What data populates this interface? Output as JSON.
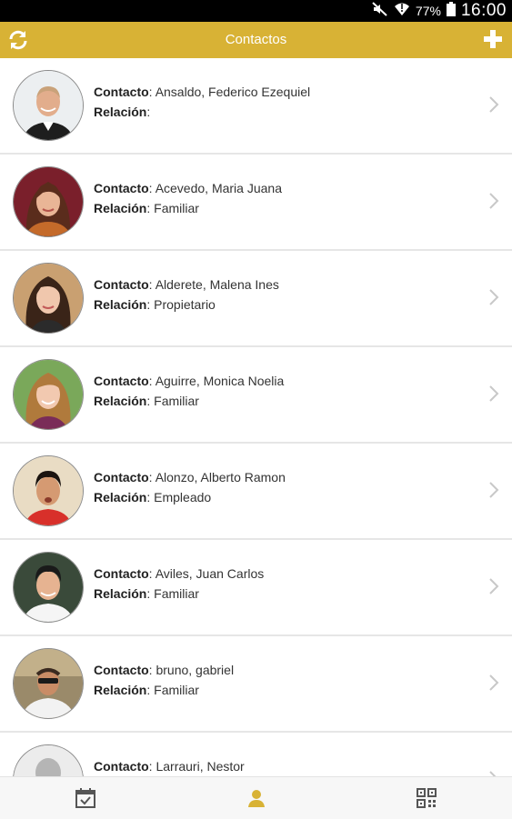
{
  "status_bar": {
    "battery": "77%",
    "time": "16:00"
  },
  "appbar": {
    "title": "Contactos",
    "left_icon": "refresh-icon",
    "right_icon": "plus-icon"
  },
  "labels": {
    "contacto": "Contacto",
    "relacion": "Relación",
    "sep": ": "
  },
  "contacts": [
    {
      "name": "Ansaldo, Federico Ezequiel",
      "relation": ""
    },
    {
      "name": "Acevedo, Maria Juana",
      "relation": "Familiar"
    },
    {
      "name": "Alderete, Malena Ines",
      "relation": "Propietario"
    },
    {
      "name": "Aguirre, Monica Noelia",
      "relation": "Familiar"
    },
    {
      "name": "Alonzo, Alberto Ramon",
      "relation": "Empleado"
    },
    {
      "name": "Aviles, Juan Carlos",
      "relation": "Familiar"
    },
    {
      "name": "bruno, gabriel",
      "relation": "Familiar"
    },
    {
      "name": "Larrauri, Nestor",
      "relation": ""
    }
  ],
  "bottom_nav": [
    {
      "icon": "calendar-check-icon",
      "active": false
    },
    {
      "icon": "person-icon",
      "active": true
    },
    {
      "icon": "qr-code-icon",
      "active": false
    }
  ],
  "colors": {
    "accent": "#d8b235",
    "inactive_icon": "#555555",
    "chevron": "#c8c8c8"
  }
}
